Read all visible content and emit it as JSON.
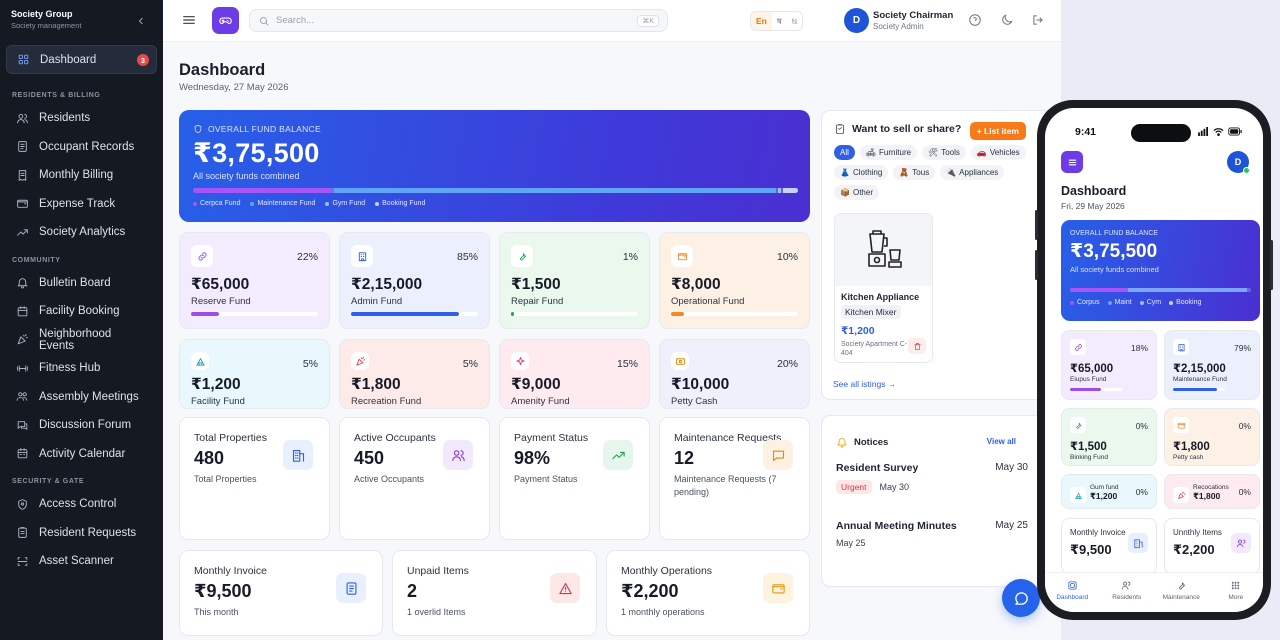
{
  "sidebar": {
    "brand": "Society Group",
    "brand_sub": "Society management",
    "dashboard": {
      "label": "Dashboard",
      "badge": "3"
    },
    "sections": [
      {
        "title": "RESIDENTS & BILLING",
        "items": [
          "Residents",
          "Occupant Records",
          "Monthly Billing",
          "Expense Track",
          "Society Analytics"
        ]
      },
      {
        "title": "COMMUNITY",
        "items": [
          "Bulletin Board",
          "Facility Booking",
          "Neighborhood Events",
          "Fitness Hub",
          "Assembly Meetings",
          "Discussion Forum",
          "Activity Calendar"
        ]
      },
      {
        "title": "SECURITY & GATE",
        "items": [
          "Access Control",
          "Resident Requests",
          "Asset Scanner"
        ]
      }
    ]
  },
  "topbar": {
    "search_placeholder": "Search...",
    "search_shortcut": "⌘K",
    "lang": [
      "En",
      "ष",
      "ઘ"
    ],
    "user_initial": "D",
    "user_name": "Society Chairman",
    "user_role": "Society Admin"
  },
  "page": {
    "title": "Dashboard",
    "date": "Wednesday, 27 May 2026"
  },
  "hero": {
    "label": "OVERALL FUND BALANCE",
    "amount": "₹3,75,500",
    "sub": "All society funds combined",
    "legend": [
      {
        "name": "Cerpca Fund",
        "color": "#a855f7",
        "share": 0.23
      },
      {
        "name": "Maintenance Fund",
        "color": "#60a5fa",
        "share": 0.73
      },
      {
        "name": "Gym Fund",
        "color": "#93c5fd",
        "share": 0.005
      },
      {
        "name": "Booking Fund",
        "color": "#c7d2fe",
        "share": 0.025
      }
    ]
  },
  "funds": [
    {
      "amount": "₹65,000",
      "name": "Reserve Fund",
      "pct": "22%",
      "fill": 0.22,
      "bg": "#f3ecfe",
      "accent": "#9b4de6",
      "icon": "link-icon"
    },
    {
      "amount": "₹2,15,000",
      "name": "Admin Fund",
      "pct": "85%",
      "fill": 0.85,
      "bg": "#ecf0fd",
      "accent": "#2f5fe6",
      "icon": "building-icon"
    },
    {
      "amount": "₹1,500",
      "name": "Repair Fund",
      "pct": "1%",
      "fill": 0.01,
      "bg": "#eaf8ee",
      "accent": "#22a55a",
      "icon": "wrench-icon"
    },
    {
      "amount": "₹8,000",
      "name": "Operational Fund",
      "pct": "10%",
      "fill": 0.1,
      "bg": "#fdf1e6",
      "accent": "#f08a24",
      "icon": "wallet-icon"
    },
    {
      "amount": "₹1,200",
      "name": "Facility Fund",
      "pct": "5%",
      "fill": 0.05,
      "bg": "#e8f8fc",
      "accent": "#14a3c7",
      "icon": "facility-icon"
    },
    {
      "amount": "₹1,800",
      "name": "Recreation Fund",
      "pct": "5%",
      "fill": 0.05,
      "bg": "#fdebea",
      "accent": "#e5484d",
      "icon": "party-icon"
    },
    {
      "amount": "₹9,000",
      "name": "Amenity Fund",
      "pct": "15%",
      "fill": 0.15,
      "bg": "#fdebf0",
      "accent": "#d63a78",
      "icon": "sparkle-icon"
    },
    {
      "amount": "₹10,000",
      "name": "Petty Cash",
      "pct": "20%",
      "fill": 0.2,
      "bg": "#eef0fb",
      "accent": "#e08a00",
      "icon": "cash-icon"
    }
  ],
  "stats": [
    {
      "title": "Total Properties",
      "value": "480",
      "sub": "Total Properties",
      "icon": "buildings-icon",
      "bg": "#e8effd",
      "color": "#2f5fe6"
    },
    {
      "title": "Active Occupants",
      "value": "450",
      "sub": "Active Occupants",
      "icon": "users-icon",
      "bg": "#f3e9fc",
      "color": "#8b3fd9"
    },
    {
      "title": "Payment Status",
      "value": "98%",
      "sub": "Payment Status",
      "icon": "trend-up-icon",
      "bg": "#e7f6ec",
      "color": "#22a55a"
    },
    {
      "title": "Maintenance Requests",
      "value": "12",
      "sub": "Maintenance Requests (7 pending)",
      "icon": "chat-icon",
      "bg": "#fdf1e3",
      "color": "#e08a10"
    },
    {
      "title": "Monthly Invoice",
      "value": "₹9,500",
      "sub": "This month",
      "icon": "invoice-icon",
      "bg": "#e8effd",
      "color": "#2f5fe6"
    },
    {
      "title": "Unpaid Items",
      "value": "2",
      "sub": "1 overlid Items",
      "icon": "warning-icon",
      "bg": "#fde8e8",
      "color": "#d9363e"
    },
    {
      "title": "Monthly Operations",
      "value": "₹2,200",
      "sub": "1 monthly operations",
      "icon": "wallet-icon",
      "bg": "#fdf3df",
      "color": "#e09a10"
    }
  ],
  "market": {
    "title": "Want to sell or share?",
    "list_button": "+ List item",
    "chips": [
      {
        "label": "All",
        "glyph": ""
      },
      {
        "label": "Furniture",
        "glyph": "🛋"
      },
      {
        "label": "Tools",
        "glyph": "🛠"
      },
      {
        "label": "Vehicles",
        "glyph": "🚗"
      },
      {
        "label": "Clothing",
        "glyph": "👗"
      },
      {
        "label": "Tous",
        "glyph": "🧸"
      },
      {
        "label": "Appliances",
        "glyph": "🔌"
      },
      {
        "label": "Other",
        "glyph": "📦"
      }
    ],
    "product": {
      "title": "Kitchen Appliance",
      "tag": "Kitchen Mixer",
      "price": "₹1,200",
      "location": "Society Apartment C-404"
    },
    "see_all": "See all istings →"
  },
  "notices": {
    "title": "Notices",
    "view_all": "View all",
    "items": [
      {
        "title": "Resident Survey",
        "date": "May 30",
        "badge": "Urgent",
        "sub": "May 30"
      },
      {
        "title": "Annual Meeting Minutes",
        "date": "May 25",
        "badge": "",
        "sub": "May 25"
      }
    ]
  },
  "phone": {
    "time": "9:41",
    "avatar": "D",
    "title": "Dashboard",
    "date": "Fri, 29 May 2026",
    "hero": {
      "label": "OVERALL FUND BALANCE",
      "amount": "₹3,75,500",
      "sub": "All society funds combined",
      "legend": [
        "Corpus",
        "Maint",
        "Cym",
        "Booking"
      ]
    },
    "funds": [
      {
        "amount": "₹65,000",
        "name": "Eiupus Fund",
        "pct": "18%",
        "fill": 0.6,
        "bg": "#f3ecfe",
        "accent": "#9b4de6"
      },
      {
        "amount": "₹2,15,000",
        "name": "Maintenance Fund",
        "pct": "79%",
        "fill": 0.85,
        "bg": "#ecf0fd",
        "accent": "#2f5fe6"
      },
      {
        "amount": "₹1,500",
        "name": "Binking Fund",
        "pct": "0%",
        "fill": 0,
        "bg": "#eaf8ee",
        "accent": "#22a55a"
      },
      {
        "amount": "₹1,800",
        "name": "Petty cash",
        "pct": "0%",
        "fill": 0,
        "bg": "#fdf1e6",
        "accent": "#f08a24"
      },
      {
        "amount": "₹1,200",
        "name": "Gum fund",
        "pct": "0%",
        "fill": 0,
        "bg": "#e8f8fc",
        "accent": "#14a3c7"
      },
      {
        "amount": "₹1,800",
        "name": "Recocations",
        "pct": "0%",
        "fill": 0,
        "bg": "#fdebf0",
        "accent": "#d63a78"
      }
    ],
    "stats": [
      {
        "title": "Monthly Invoice",
        "value": "₹9,500"
      },
      {
        "title": "Unnthly Items",
        "value": "₹2,200"
      }
    ],
    "tabs": [
      "Dashboard",
      "Residents",
      "Maintenance",
      "More"
    ]
  }
}
